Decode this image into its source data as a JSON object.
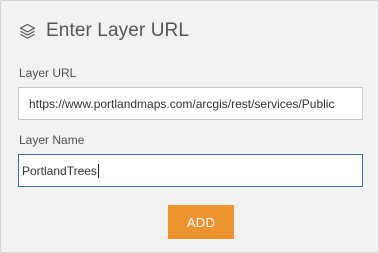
{
  "dialog": {
    "title": "Enter Layer URL",
    "title_icon": "layers-icon"
  },
  "url_field": {
    "label": "Layer URL",
    "value": "https://www.portlandmaps.com/arcgis/rest/services/Public"
  },
  "name_field": {
    "label": "Layer Name",
    "value": "PortlandTrees"
  },
  "add_button": {
    "label": "ADD",
    "color": "#ef9331"
  },
  "colors": {
    "panel_background": "#f2f2f2",
    "focus_border": "#3b72b2"
  }
}
